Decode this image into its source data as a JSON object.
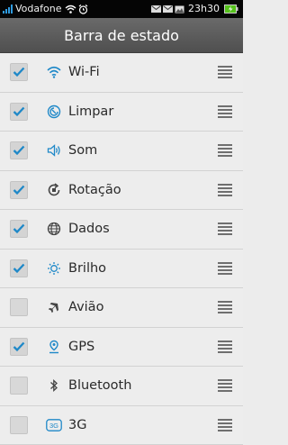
{
  "status_bar": {
    "carrier": "Vodafone",
    "time": "23h30",
    "icons": [
      "signal-icon",
      "wifi-icon",
      "alarm-icon",
      "mail-icon",
      "mail-icon",
      "picture-icon",
      "battery-icon"
    ]
  },
  "title": "Barra de estado",
  "accent_color": "#1e88c8",
  "items": [
    {
      "label": "Wi-Fi",
      "checked": true,
      "icon": "wifi-icon"
    },
    {
      "label": "Limpar",
      "checked": true,
      "icon": "clean-icon"
    },
    {
      "label": "Som",
      "checked": true,
      "icon": "speaker-icon"
    },
    {
      "label": "Rotação",
      "checked": true,
      "icon": "rotation-icon"
    },
    {
      "label": "Dados",
      "checked": true,
      "icon": "globe-icon"
    },
    {
      "label": "Brilho",
      "checked": true,
      "icon": "brightness-icon"
    },
    {
      "label": "Avião",
      "checked": false,
      "icon": "airplane-icon"
    },
    {
      "label": "GPS",
      "checked": true,
      "icon": "gps-icon"
    },
    {
      "label": "Bluetooth",
      "checked": false,
      "icon": "bluetooth-icon"
    },
    {
      "label": "3G",
      "checked": false,
      "icon": "3g-icon"
    }
  ]
}
